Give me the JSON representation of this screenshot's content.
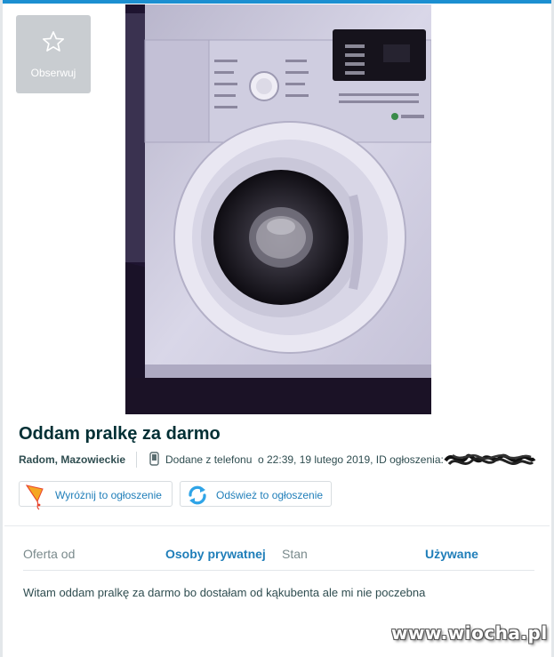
{
  "observe": {
    "label": "Obserwuj",
    "icon": "star-outline-icon"
  },
  "listing": {
    "title": "Oddam pralkę za darmo",
    "location": "Radom, Mazowieckie",
    "added_via": "Dodane z telefonu",
    "added_at": "o 22:39, 19 lutego 2019, ID ogłoszenia:"
  },
  "actions": {
    "feature_label": "Wyróżnij to ogłoszenie",
    "refresh_label": "Odśwież to ogłoszenie"
  },
  "params": [
    {
      "label": "Oferta od",
      "value": "Osoby prywatnej"
    },
    {
      "label": "Stan",
      "value": "Używane"
    }
  ],
  "description": "Witam oddam pralkę za darmo bo dostałam od kąkubenta ale mi nie poczebna",
  "watermark": "www.wiocha.pl",
  "colors": {
    "accent_blue": "#1f7eb9",
    "title_dark": "#002f34",
    "observe_bg": "#c9cdd1",
    "top_bar": "#1c8fd1"
  }
}
